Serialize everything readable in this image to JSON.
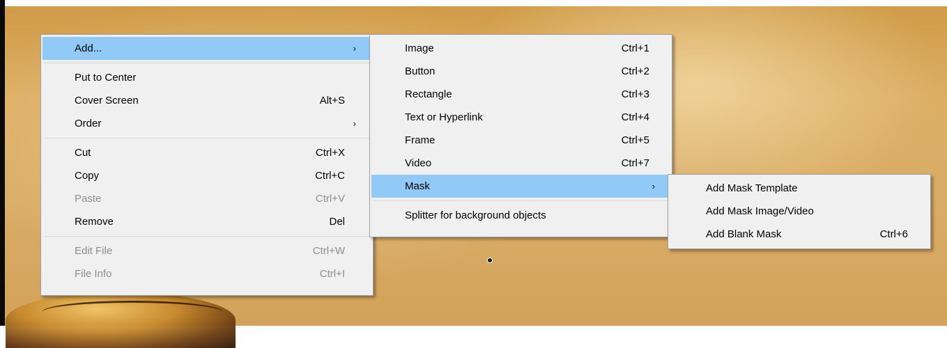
{
  "icons": {
    "submenu_arrow": "chevron-right-icon",
    "cursor": "cursor-icon"
  },
  "main_menu": {
    "items": [
      {
        "label": "Add...",
        "shortcut": "",
        "has_submenu": true,
        "highlighted": true,
        "disabled": false
      },
      {
        "label": "Put to Center",
        "shortcut": "",
        "has_submenu": false,
        "disabled": false
      },
      {
        "label": "Cover Screen",
        "shortcut": "Alt+S",
        "has_submenu": false,
        "disabled": false
      },
      {
        "label": "Order",
        "shortcut": "",
        "has_submenu": true,
        "disabled": false
      },
      {
        "label": "Cut",
        "shortcut": "Ctrl+X",
        "has_submenu": false,
        "disabled": false
      },
      {
        "label": "Copy",
        "shortcut": "Ctrl+C",
        "has_submenu": false,
        "disabled": false
      },
      {
        "label": "Paste",
        "shortcut": "Ctrl+V",
        "has_submenu": false,
        "disabled": true
      },
      {
        "label": "Remove",
        "shortcut": "Del",
        "has_submenu": false,
        "disabled": false
      },
      {
        "label": "Edit File",
        "shortcut": "Ctrl+W",
        "has_submenu": false,
        "disabled": true
      },
      {
        "label": "File Info",
        "shortcut": "Ctrl+I",
        "has_submenu": false,
        "disabled": true
      }
    ]
  },
  "add_menu": {
    "items": [
      {
        "label": "Image",
        "shortcut": "Ctrl+1"
      },
      {
        "label": "Button",
        "shortcut": "Ctrl+2"
      },
      {
        "label": "Rectangle",
        "shortcut": "Ctrl+3"
      },
      {
        "label": "Text or Hyperlink",
        "shortcut": "Ctrl+4"
      },
      {
        "label": "Frame",
        "shortcut": "Ctrl+5"
      },
      {
        "label": "Video",
        "shortcut": "Ctrl+7"
      },
      {
        "label": "Mask",
        "shortcut": "",
        "has_submenu": true,
        "highlighted": true
      },
      {
        "label": "Splitter for background objects",
        "shortcut": ""
      }
    ]
  },
  "mask_menu": {
    "items": [
      {
        "label": "Add Mask Template",
        "shortcut": ""
      },
      {
        "label": "Add Mask Image/Video",
        "shortcut": ""
      },
      {
        "label": "Add Blank Mask",
        "shortcut": "Ctrl+6"
      }
    ]
  },
  "colors": {
    "menu_background": "#f0f0f0",
    "highlight": "#91c9f7",
    "disabled_text": "#8d8d8d"
  }
}
